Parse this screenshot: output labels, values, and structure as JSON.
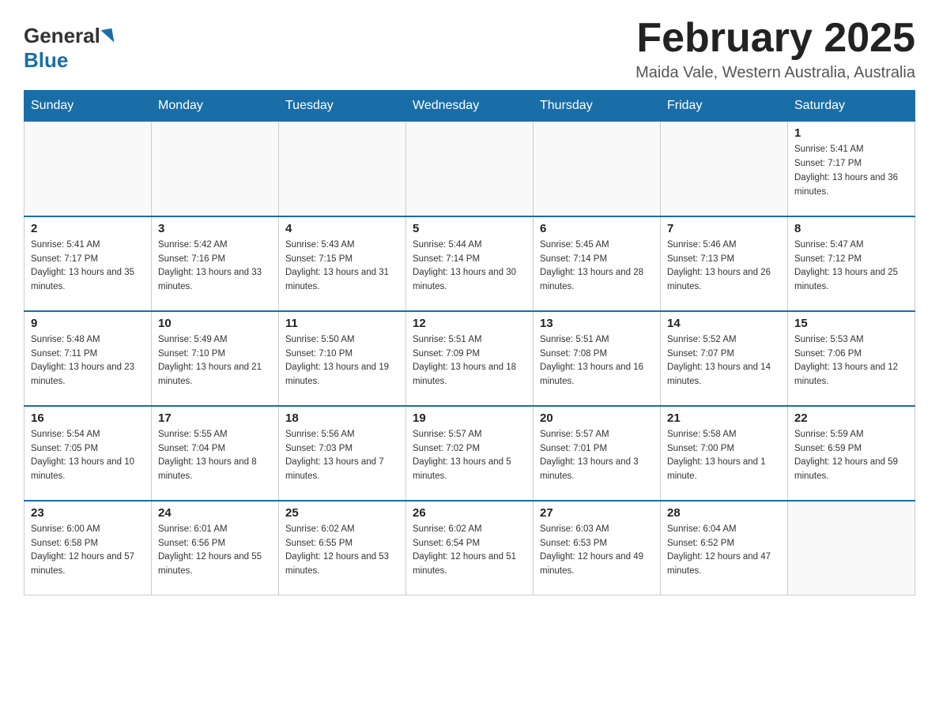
{
  "header": {
    "logo_general": "General",
    "logo_blue": "Blue",
    "title": "February 2025",
    "subtitle": "Maida Vale, Western Australia, Australia"
  },
  "days_of_week": [
    "Sunday",
    "Monday",
    "Tuesday",
    "Wednesday",
    "Thursday",
    "Friday",
    "Saturday"
  ],
  "weeks": [
    [
      {
        "day": "",
        "info": ""
      },
      {
        "day": "",
        "info": ""
      },
      {
        "day": "",
        "info": ""
      },
      {
        "day": "",
        "info": ""
      },
      {
        "day": "",
        "info": ""
      },
      {
        "day": "",
        "info": ""
      },
      {
        "day": "1",
        "info": "Sunrise: 5:41 AM\nSunset: 7:17 PM\nDaylight: 13 hours and 36 minutes."
      }
    ],
    [
      {
        "day": "2",
        "info": "Sunrise: 5:41 AM\nSunset: 7:17 PM\nDaylight: 13 hours and 35 minutes."
      },
      {
        "day": "3",
        "info": "Sunrise: 5:42 AM\nSunset: 7:16 PM\nDaylight: 13 hours and 33 minutes."
      },
      {
        "day": "4",
        "info": "Sunrise: 5:43 AM\nSunset: 7:15 PM\nDaylight: 13 hours and 31 minutes."
      },
      {
        "day": "5",
        "info": "Sunrise: 5:44 AM\nSunset: 7:14 PM\nDaylight: 13 hours and 30 minutes."
      },
      {
        "day": "6",
        "info": "Sunrise: 5:45 AM\nSunset: 7:14 PM\nDaylight: 13 hours and 28 minutes."
      },
      {
        "day": "7",
        "info": "Sunrise: 5:46 AM\nSunset: 7:13 PM\nDaylight: 13 hours and 26 minutes."
      },
      {
        "day": "8",
        "info": "Sunrise: 5:47 AM\nSunset: 7:12 PM\nDaylight: 13 hours and 25 minutes."
      }
    ],
    [
      {
        "day": "9",
        "info": "Sunrise: 5:48 AM\nSunset: 7:11 PM\nDaylight: 13 hours and 23 minutes."
      },
      {
        "day": "10",
        "info": "Sunrise: 5:49 AM\nSunset: 7:10 PM\nDaylight: 13 hours and 21 minutes."
      },
      {
        "day": "11",
        "info": "Sunrise: 5:50 AM\nSunset: 7:10 PM\nDaylight: 13 hours and 19 minutes."
      },
      {
        "day": "12",
        "info": "Sunrise: 5:51 AM\nSunset: 7:09 PM\nDaylight: 13 hours and 18 minutes."
      },
      {
        "day": "13",
        "info": "Sunrise: 5:51 AM\nSunset: 7:08 PM\nDaylight: 13 hours and 16 minutes."
      },
      {
        "day": "14",
        "info": "Sunrise: 5:52 AM\nSunset: 7:07 PM\nDaylight: 13 hours and 14 minutes."
      },
      {
        "day": "15",
        "info": "Sunrise: 5:53 AM\nSunset: 7:06 PM\nDaylight: 13 hours and 12 minutes."
      }
    ],
    [
      {
        "day": "16",
        "info": "Sunrise: 5:54 AM\nSunset: 7:05 PM\nDaylight: 13 hours and 10 minutes."
      },
      {
        "day": "17",
        "info": "Sunrise: 5:55 AM\nSunset: 7:04 PM\nDaylight: 13 hours and 8 minutes."
      },
      {
        "day": "18",
        "info": "Sunrise: 5:56 AM\nSunset: 7:03 PM\nDaylight: 13 hours and 7 minutes."
      },
      {
        "day": "19",
        "info": "Sunrise: 5:57 AM\nSunset: 7:02 PM\nDaylight: 13 hours and 5 minutes."
      },
      {
        "day": "20",
        "info": "Sunrise: 5:57 AM\nSunset: 7:01 PM\nDaylight: 13 hours and 3 minutes."
      },
      {
        "day": "21",
        "info": "Sunrise: 5:58 AM\nSunset: 7:00 PM\nDaylight: 13 hours and 1 minute."
      },
      {
        "day": "22",
        "info": "Sunrise: 5:59 AM\nSunset: 6:59 PM\nDaylight: 12 hours and 59 minutes."
      }
    ],
    [
      {
        "day": "23",
        "info": "Sunrise: 6:00 AM\nSunset: 6:58 PM\nDaylight: 12 hours and 57 minutes."
      },
      {
        "day": "24",
        "info": "Sunrise: 6:01 AM\nSunset: 6:56 PM\nDaylight: 12 hours and 55 minutes."
      },
      {
        "day": "25",
        "info": "Sunrise: 6:02 AM\nSunset: 6:55 PM\nDaylight: 12 hours and 53 minutes."
      },
      {
        "day": "26",
        "info": "Sunrise: 6:02 AM\nSunset: 6:54 PM\nDaylight: 12 hours and 51 minutes."
      },
      {
        "day": "27",
        "info": "Sunrise: 6:03 AM\nSunset: 6:53 PM\nDaylight: 12 hours and 49 minutes."
      },
      {
        "day": "28",
        "info": "Sunrise: 6:04 AM\nSunset: 6:52 PM\nDaylight: 12 hours and 47 minutes."
      },
      {
        "day": "",
        "info": ""
      }
    ]
  ]
}
